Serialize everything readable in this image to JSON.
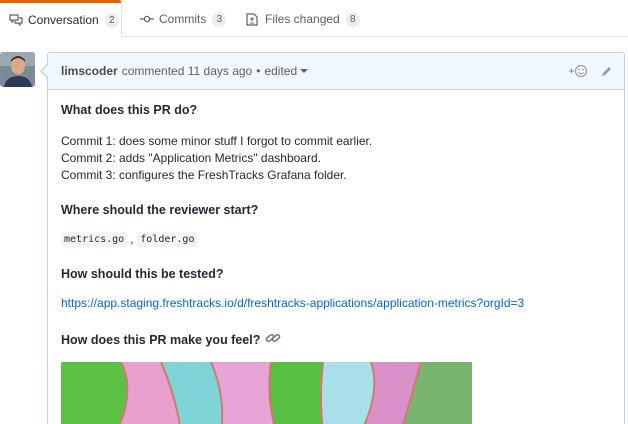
{
  "tabs": [
    {
      "label": "Conversation",
      "count": "2"
    },
    {
      "label": "Commits",
      "count": "3"
    },
    {
      "label": "Files changed",
      "count": "8"
    }
  ],
  "comment": {
    "author": "limscoder",
    "meta": "commented 11 days ago",
    "separator": "•",
    "edited": "edited",
    "heading_what": "What does this PR do?",
    "commit_lines": [
      "Commit 1: does some minor stuff I forgot to commit earlier.",
      "Commit 2: adds \"Application Metrics\" dashboard.",
      "Commit 3: configures the FreshTracks Grafana folder."
    ],
    "heading_where": "Where should the reviewer start?",
    "code_files": [
      "metrics.go",
      "folder.go"
    ],
    "code_separator": ",",
    "heading_tested": "How should this be tested?",
    "test_link": "https://app.staging.freshtracks.io/d/freshtracks-applications/application-metrics?orgId=3",
    "heading_feel": "How does this PR make you feel?"
  },
  "colors": {
    "accent_tab": "#e36209",
    "link": "#0366d6",
    "header_bg": "#f1f8ff",
    "border": "#c0d3eb"
  },
  "icons": [
    "conversation-icon",
    "commits-icon",
    "files-changed-icon",
    "add-reaction-icon",
    "edit-pencil-icon",
    "link-icon"
  ]
}
